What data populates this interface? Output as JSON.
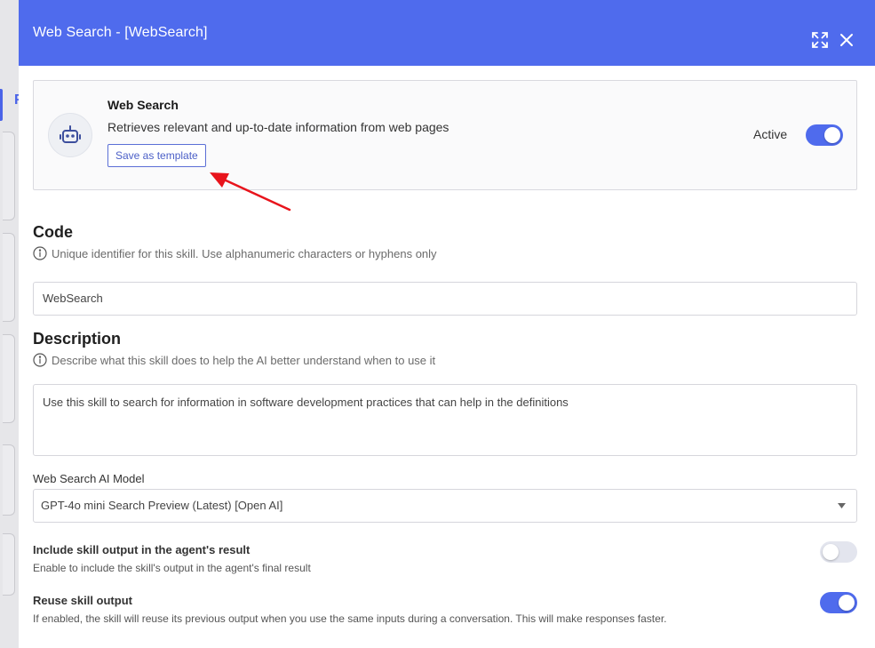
{
  "modal": {
    "title": "Web Search - [WebSearch]",
    "header_color": "#4f6bed",
    "icons": [
      "expand-icon",
      "close-icon"
    ]
  },
  "skill": {
    "name": "Web Search",
    "description": "Retrieves relevant and up-to-date information from web pages",
    "save_template_label": "Save as template",
    "active_label": "Active",
    "active": true,
    "icon": "robot-icon"
  },
  "code": {
    "title": "Code",
    "hint": "Unique identifier for this skill. Use alphanumeric characters or hyphens only",
    "value": "WebSearch"
  },
  "description": {
    "title": "Description",
    "hint": "Describe what this skill does to help the AI better understand when to use it",
    "value": "Use this skill to search for information in software development practices that can help in the definitions"
  },
  "model": {
    "label": "Web Search AI Model",
    "selected": "GPT-4o mini Search Preview (Latest) [Open AI]"
  },
  "options": {
    "include_output": {
      "title": "Include skill output in the agent's result",
      "description": "Enable to include the skill's output in the agent's final result",
      "enabled": false
    },
    "reuse_output": {
      "title": "Reuse skill output",
      "description": "If enabled, the skill will reuse its previous output when you use the same inputs during a conversation. This will make responses faster.",
      "enabled": true
    }
  },
  "colors": {
    "accent": "#4f6bed",
    "annotation_arrow": "#e8141c"
  }
}
